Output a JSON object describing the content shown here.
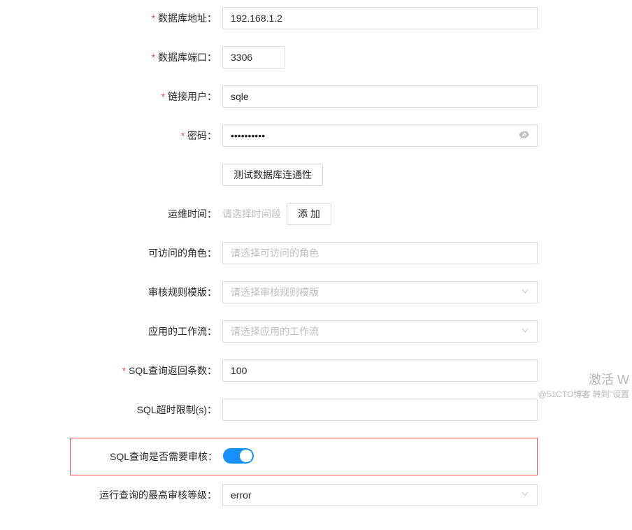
{
  "form": {
    "db_address": {
      "label": "数据库地址：",
      "value": "192.168.1.2"
    },
    "db_port": {
      "label": "数据库端口：",
      "value": "3306"
    },
    "conn_user": {
      "label": "链接用户：",
      "value": "sqle"
    },
    "password": {
      "label": "密码：",
      "value": "••••••••••"
    },
    "test_conn_btn": "测试数据库连通性",
    "maint_time": {
      "label": "运维时间：",
      "placeholder": "请选择时间段",
      "add_btn": "添 加"
    },
    "roles": {
      "label": "可访问的角色：",
      "placeholder": "请选择可访问的角色"
    },
    "audit_template": {
      "label": "审核规则模版：",
      "placeholder": "请选择审核规则模版"
    },
    "workflow": {
      "label": "应用的工作流：",
      "placeholder": "请选择应用的工作流"
    },
    "sql_rows": {
      "label": "SQL查询返回条数：",
      "value": "100"
    },
    "sql_timeout": {
      "label": "SQL超时限制(s)：",
      "value": ""
    },
    "need_audit": {
      "label": "SQL查询是否需要审核：",
      "checked": true
    },
    "max_audit_level": {
      "label": "运行查询的最高审核等级：",
      "value": "error"
    }
  },
  "watermark": {
    "line1": "激活 W",
    "line2": "@51CTO博客     转到\"设置"
  }
}
